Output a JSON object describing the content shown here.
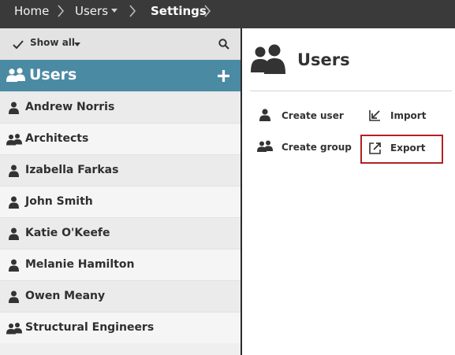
{
  "breadcrumb": {
    "items": [
      "Home",
      "Users",
      "Settings"
    ]
  },
  "filter": {
    "label": "Show all"
  },
  "panel": {
    "title": "Users"
  },
  "list": [
    {
      "label": "Andrew Norris",
      "type": "user"
    },
    {
      "label": "Architects",
      "type": "group"
    },
    {
      "label": "Izabella Farkas",
      "type": "user"
    },
    {
      "label": "John Smith",
      "type": "user"
    },
    {
      "label": "Katie O'Keefe",
      "type": "user"
    },
    {
      "label": "Melanie Hamilton",
      "type": "user"
    },
    {
      "label": "Owen Meany",
      "type": "user"
    },
    {
      "label": "Structural Engineers",
      "type": "group"
    }
  ],
  "detail": {
    "title": "Users",
    "actions": {
      "create_user": "Create user",
      "import": "Import",
      "create_group": "Create group",
      "export": "Export"
    }
  },
  "colors": {
    "topbar": "#3a3a3a",
    "header_accent": "#4a8aa3",
    "highlight_border": "#b22222"
  }
}
